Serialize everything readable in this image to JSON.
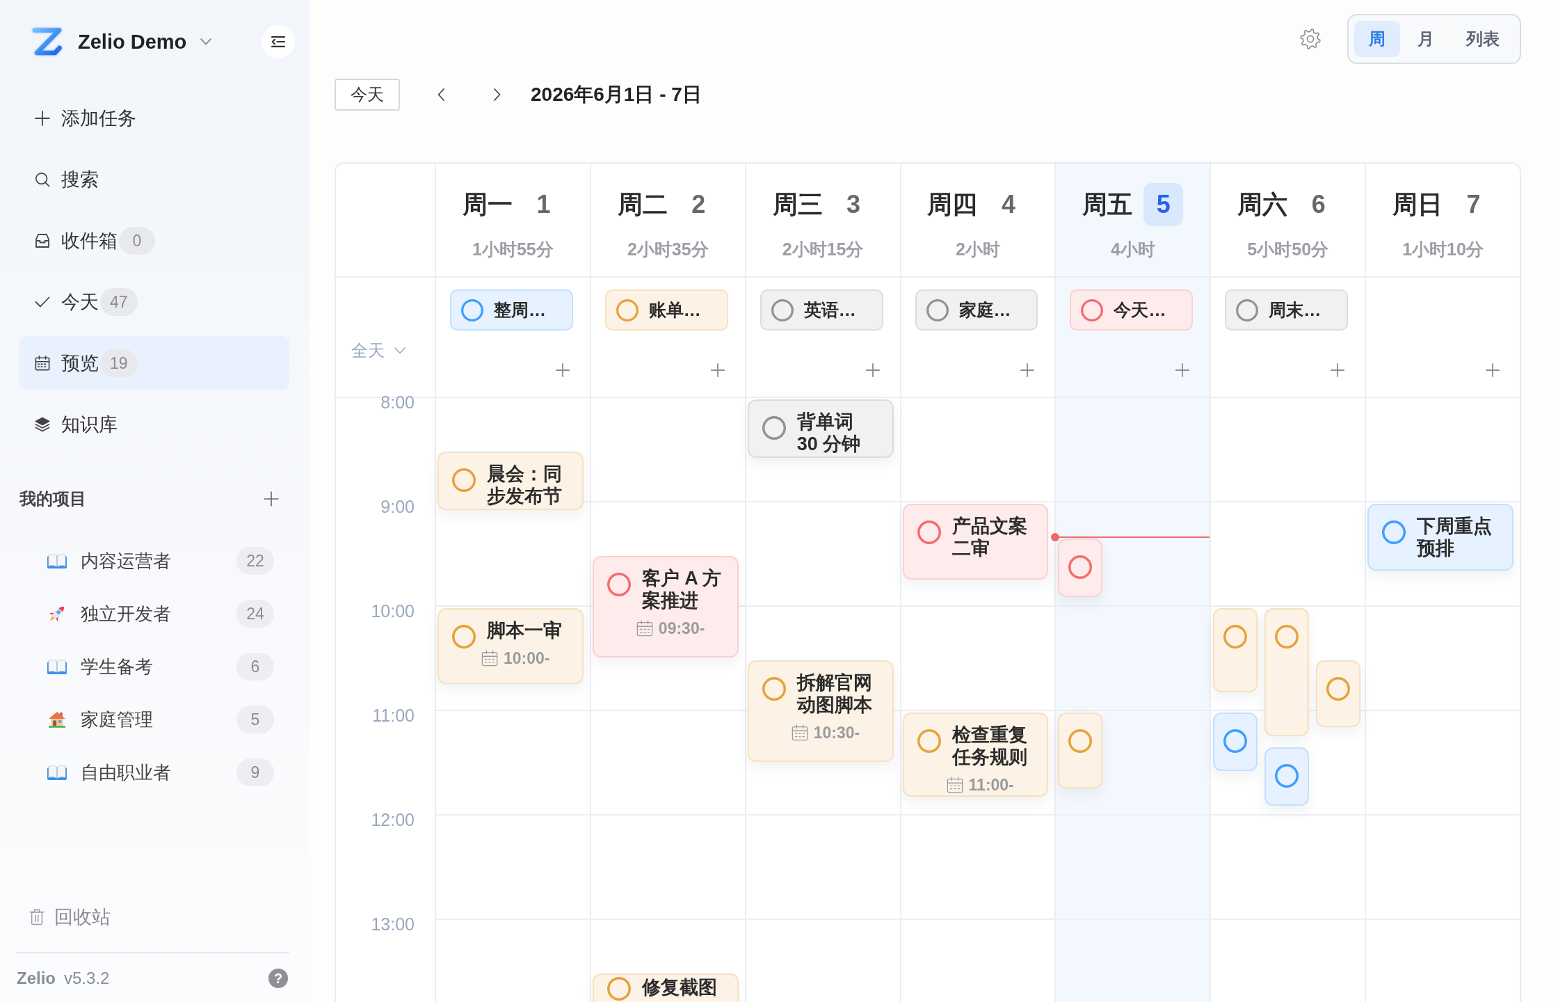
{
  "sidebar": {
    "workspace": "Zelio Demo",
    "nav": [
      {
        "label": "添加任务",
        "kind": "add",
        "selected": false
      },
      {
        "label": "搜索",
        "kind": "search",
        "selected": false
      },
      {
        "label": "收件箱",
        "kind": "inbox",
        "count": "0",
        "selected": false
      },
      {
        "label": "今天",
        "kind": "today",
        "count": "47",
        "selected": false
      },
      {
        "label": "预览",
        "kind": "preview",
        "count": "19",
        "selected": true
      },
      {
        "label": "知识库",
        "kind": "library",
        "selected": false
      }
    ],
    "projects_title": "我的项目",
    "projects": [
      {
        "name": "内容运营者",
        "kind": "book",
        "count": "22"
      },
      {
        "name": "独立开发者",
        "kind": "rocket",
        "count": "24"
      },
      {
        "name": "学生备考",
        "kind": "book",
        "count": "6"
      },
      {
        "name": "家庭管理",
        "kind": "house",
        "count": "5"
      },
      {
        "name": "自由职业者",
        "kind": "book",
        "count": "9"
      }
    ],
    "trash": "回收站",
    "footer": {
      "app": "Zelio",
      "version": "v5.3.2",
      "help": "?"
    }
  },
  "toolbar": {
    "views": [
      {
        "label": "周",
        "selected": true
      },
      {
        "label": "月",
        "selected": false
      },
      {
        "label": "列表",
        "selected": false
      }
    ],
    "today_button": "今天",
    "range": "2026年6月1日 - 7日"
  },
  "calendar": {
    "all_day_label": "全天",
    "hours": [
      "8:00",
      "9:00",
      "10:00",
      "11:00",
      "12:00",
      "13:00"
    ],
    "days": [
      {
        "weekday": "周一",
        "date": "1",
        "total": "1小时55分",
        "today": false,
        "all_day": [
          {
            "title": "整周…",
            "color": "#409eff"
          }
        ],
        "events": [
          {
            "title": "晨会：同步发布节",
            "color": "#e6a23c"
          },
          {
            "title": "脚本一审",
            "time": "10:00-",
            "color": "#e6a23c"
          }
        ]
      },
      {
        "weekday": "周二",
        "date": "2",
        "total": "2小时35分",
        "today": false,
        "all_day": [
          {
            "title": "账单…",
            "color": "#e6a23c"
          }
        ],
        "events": [
          {
            "title": "客户 A 方案推进",
            "time": "09:30-",
            "color": "#f56c6c"
          },
          {
            "title": "修复截图",
            "color": "#e6a23c"
          }
        ]
      },
      {
        "weekday": "周三",
        "date": "3",
        "total": "2小时15分",
        "today": false,
        "all_day": [
          {
            "title": "英语…",
            "color": "#909399"
          }
        ],
        "events": [
          {
            "title": "背单词 30 分钟",
            "color": "#909399"
          },
          {
            "title": "拆解官网动图脚本",
            "time": "10:30-",
            "color": "#e6a23c"
          }
        ]
      },
      {
        "weekday": "周四",
        "date": "4",
        "total": "2小时",
        "today": false,
        "all_day": [
          {
            "title": "家庭…",
            "color": "#909399"
          }
        ],
        "events": [
          {
            "title": "产品文案二审",
            "color": "#f56c6c"
          },
          {
            "title": "检查重复任务规则",
            "time": "11:00-",
            "color": "#e6a23c"
          }
        ]
      },
      {
        "weekday": "周五",
        "date": "5",
        "total": "4小时",
        "today": true,
        "all_day": [
          {
            "title": "今天…",
            "color": "#f56c6c"
          }
        ],
        "events": [
          {
            "color": "#f56c6c"
          },
          {
            "color": "#e6a23c"
          }
        ]
      },
      {
        "weekday": "周六",
        "date": "6",
        "total": "5小时50分",
        "today": false,
        "all_day": [
          {
            "title": "周末…",
            "color": "#909399"
          }
        ],
        "events": [
          {
            "color": "#e6a23c"
          },
          {
            "color": "#e6a23c"
          },
          {
            "color": "#e6a23c"
          },
          {
            "color": "#409eff"
          },
          {
            "color": "#409eff"
          }
        ]
      },
      {
        "weekday": "周日",
        "date": "7",
        "total": "1小时10分",
        "today": false,
        "events": [
          {
            "title": "下周重点预排",
            "color": "#409eff"
          }
        ]
      }
    ]
  }
}
